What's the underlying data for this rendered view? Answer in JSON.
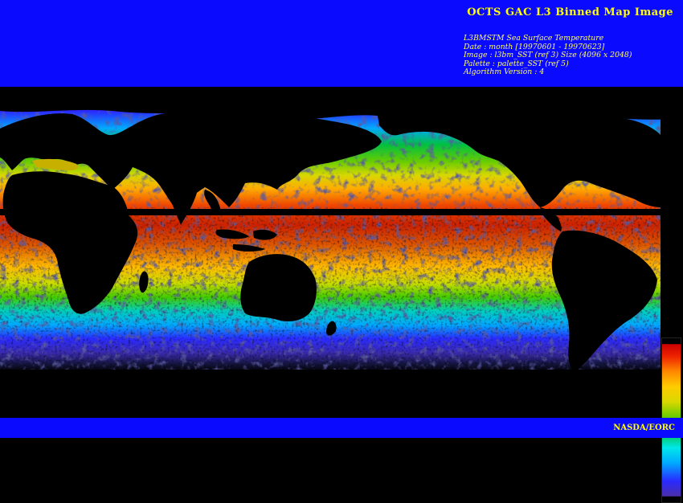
{
  "header": {
    "title": "OCTS GAC L3 Binned Map Image",
    "lines": [
      "L3BMSTM Sea Surface Temperature",
      "Date : month [19970601 - 19970623]",
      "Image : l3bm_SST (ref 3) Size (4096 x 2048)",
      "Palette : palette_SST (ref 5)",
      "Algorithm Version : 4"
    ]
  },
  "footer": {
    "credit": "NASDA/EORC"
  },
  "colors": {
    "banner": "#0a0aff",
    "title_text": "#ffff00",
    "land": "#000000",
    "palette": [
      "#4b2ea8",
      "#2a2aff",
      "#00aaff",
      "#00e8e8",
      "#00c040",
      "#66cc00",
      "#d8d800",
      "#ffcc00",
      "#ff8800",
      "#ee2200",
      "#cc0000"
    ]
  },
  "map": {
    "projection": "equirectangular",
    "center": "Pacific",
    "variable": "sea surface temperature"
  }
}
